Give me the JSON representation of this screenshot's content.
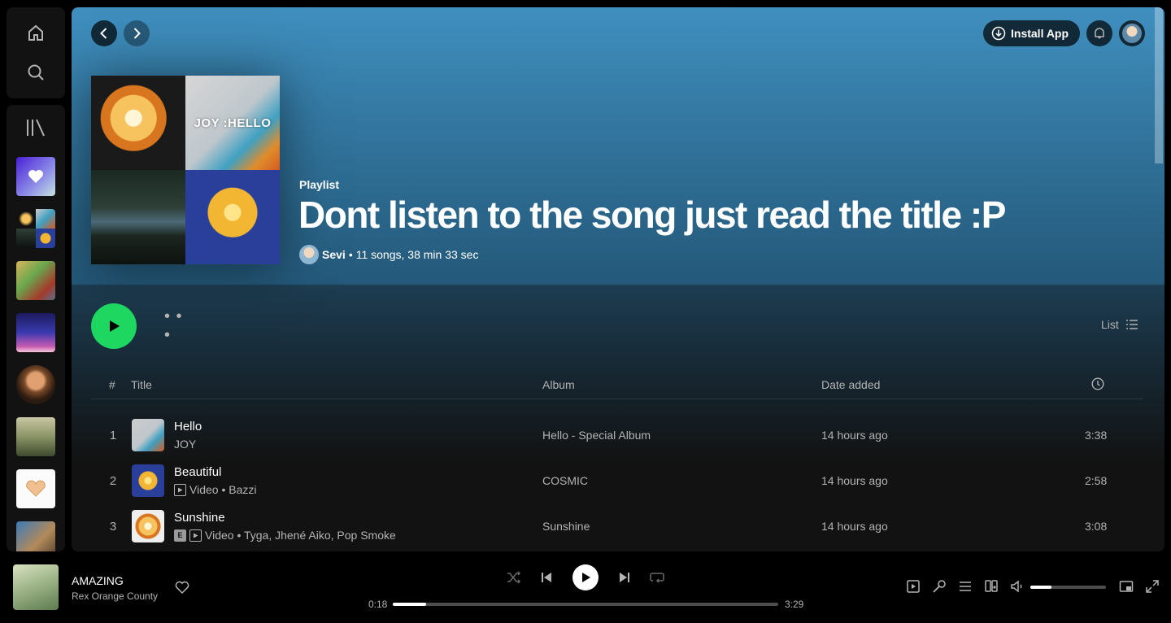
{
  "sidebar": {
    "home_icon": "home-icon",
    "search_icon": "search-icon",
    "library_icon": "library-icon"
  },
  "header": {
    "install_label": "Install App"
  },
  "playlist": {
    "type": "Playlist",
    "title": "Dont listen to the song just read the title :P",
    "cover_tile_2_text": "JOY :HELLO",
    "owner": "Sevi",
    "summary": "11 songs, 38 min 33 sec"
  },
  "controls": {
    "more": "• • •",
    "view_label": "List"
  },
  "table": {
    "headers": {
      "num": "#",
      "title": "Title",
      "album": "Album",
      "date": "Date added"
    },
    "rows": [
      {
        "num": "1",
        "title": "Hello",
        "artist": "JOY",
        "album": "Hello - Special Album",
        "date": "14 hours ago",
        "duration": "3:38",
        "video": false,
        "explicit": false
      },
      {
        "num": "2",
        "title": "Beautiful",
        "artist": "Video • Bazzi",
        "album": "COSMIC",
        "date": "14 hours ago",
        "duration": "2:58",
        "video": true,
        "explicit": false
      },
      {
        "num": "3",
        "title": "Sunshine",
        "artist": "Video • Tyga, Jhené Aiko, Pop Smoke",
        "album": "Sunshine",
        "date": "14 hours ago",
        "duration": "3:08",
        "video": true,
        "explicit": true
      }
    ]
  },
  "now_playing": {
    "title": "AMAZING",
    "artist": "Rex Orange County",
    "elapsed": "0:18",
    "total": "3:29",
    "progress_fraction": 0.086,
    "volume_fraction": 0.28
  },
  "colors": {
    "accent": "#1ed760",
    "header_top": "#3f8fbf",
    "background": "#121212"
  }
}
